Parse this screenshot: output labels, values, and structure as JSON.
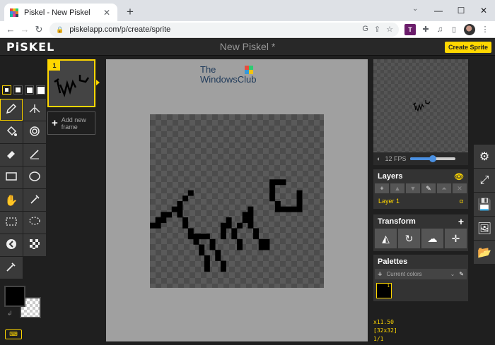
{
  "browser": {
    "tab_title": "Piskel - New Piskel",
    "url": "piskelapp.com/p/create/sprite"
  },
  "app": {
    "logo": "PiSKEL",
    "title": "New Piskel *",
    "create_label": "Create Sprite",
    "frame_number": "1",
    "add_frame_label": "Add new frame",
    "fps_label": "12 FPS",
    "fps_fraction": 0.5,
    "layers_title": "Layers",
    "layer_name": "Layer 1",
    "layer_alpha": "α",
    "transform_title": "Transform",
    "palettes_title": "Palettes",
    "palette_selected": "Current colors",
    "swatch_index": "1",
    "zoom": "x11.50",
    "dimensions": "[32x32]",
    "frame_index": "1/1",
    "watermark_line1": "The",
    "watermark_line2": "WindowsClub"
  },
  "colors": {
    "accent": "#ffd700",
    "primary_color": "#000000",
    "secondary_color": "transparent"
  },
  "icons": {
    "tools": [
      "pen-icon",
      "vertical-mirror-pen-icon",
      "paint-bucket-icon",
      "paint-same-color-icon",
      "eraser-icon",
      "stroke-icon",
      "rectangle-icon",
      "circle-icon",
      "move-hand-icon",
      "color-picker-icon",
      "rectangle-select-icon",
      "lasso-select-icon",
      "lighten-icon",
      "dithering-icon",
      "eyedropper-icon"
    ],
    "sidebar": [
      "settings-gear-icon",
      "resize-icon",
      "save-icon",
      "export-image-icon",
      "open-folder-icon"
    ]
  }
}
